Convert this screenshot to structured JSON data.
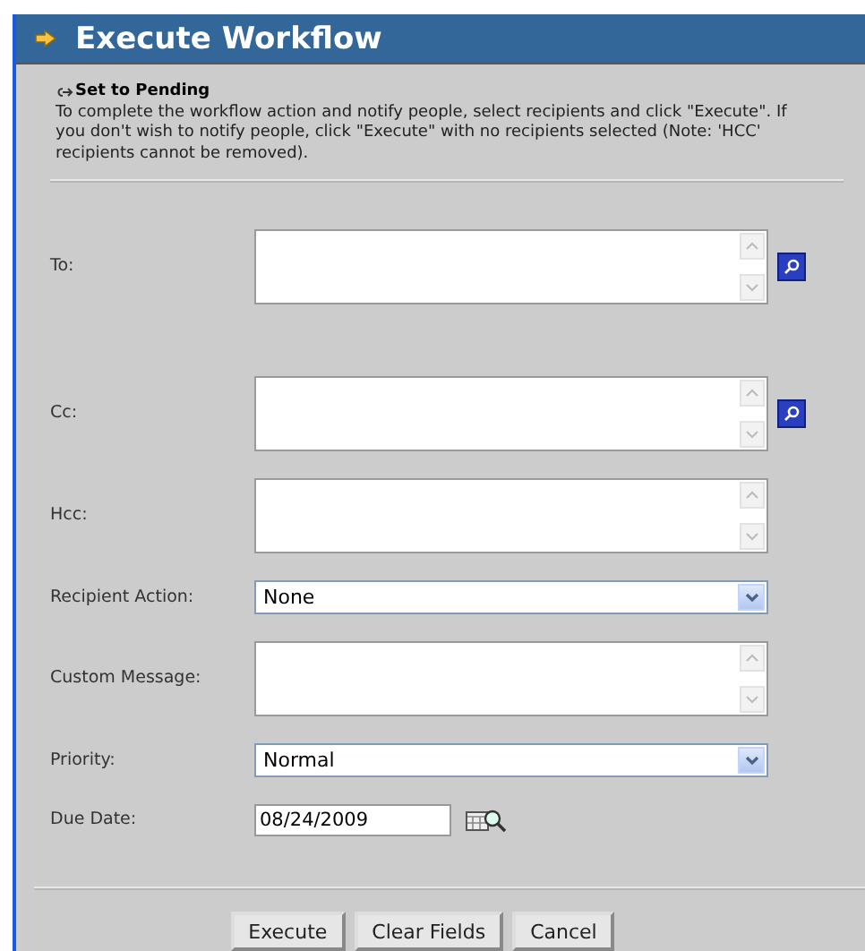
{
  "window": {
    "title": "Execute Workflow"
  },
  "action": {
    "title": "Set to Pending",
    "description": "To complete the workflow action and notify people, select recipients and click \"Execute\". If you don't wish to notify people, click \"Execute\" with no recipients selected (Note: 'HCC' recipients cannot be removed)."
  },
  "fields": [
    {
      "kind": "recipients",
      "label": "To:"
    },
    {
      "kind": "recipients",
      "label": "Cc:"
    },
    {
      "kind": "textarea",
      "label": "Hcc:"
    },
    {
      "kind": "select",
      "label": "Recipient Action:",
      "value": "None"
    },
    {
      "kind": "textarea",
      "label": "Custom Message:"
    },
    {
      "kind": "select",
      "label": "Priority:",
      "value": "Normal"
    },
    {
      "kind": "date",
      "label": "Due Date:",
      "value": "08/24/2009"
    }
  ],
  "buttons": [
    "Execute",
    "Clear Fields",
    "Cancel"
  ]
}
